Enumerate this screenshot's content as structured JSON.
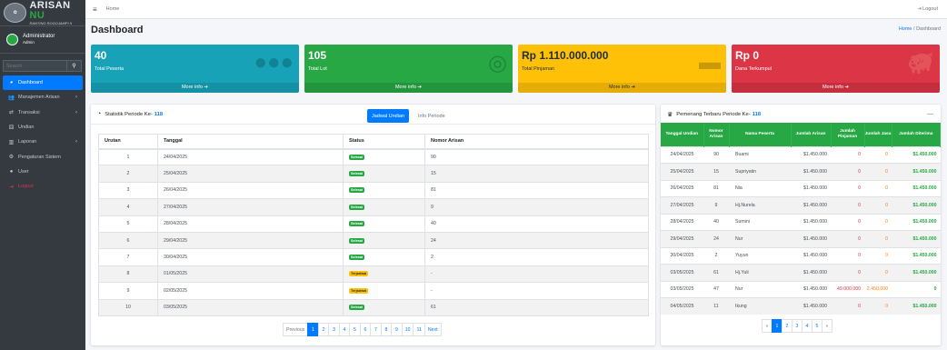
{
  "brand": {
    "logo": "logo",
    "title": "ARISAN",
    "title_accent": "NU",
    "subtitle": "RANTING ROGOJAMPI II"
  },
  "user": {
    "name": "Administrator",
    "role": "Admin"
  },
  "search": {
    "placeholder": "Search",
    "icon": "search-icon"
  },
  "sidebar": {
    "items": [
      {
        "label": "Dashboard",
        "icon": "tachometer-icon",
        "active": true,
        "arrow": ""
      },
      {
        "label": "Manajemen Arisan",
        "icon": "users-icon",
        "active": false,
        "arrow": "‹"
      },
      {
        "label": "Transaksi",
        "icon": "exchange-icon",
        "active": false,
        "arrow": "‹"
      },
      {
        "label": "Undian",
        "icon": "dice-icon",
        "active": false,
        "arrow": ""
      },
      {
        "label": "Laporan",
        "icon": "chart-icon",
        "active": false,
        "arrow": "‹"
      },
      {
        "label": "Pengaturan Sistem",
        "icon": "cogs-icon",
        "active": false,
        "arrow": ""
      },
      {
        "label": "User",
        "icon": "user-icon",
        "active": false,
        "arrow": ""
      },
      {
        "label": "Logout",
        "icon": "sign-out-icon",
        "active": false,
        "arrow": ""
      }
    ]
  },
  "topbar": {
    "home": "Home",
    "logout": "Logout"
  },
  "header": {
    "title": "Dashboard",
    "breadcrumb_home": "Home",
    "breadcrumb_sep": "/",
    "breadcrumb_current": "Dashboard"
  },
  "boxes": [
    {
      "value": "40",
      "label": "Total Peserta",
      "footer": "More info",
      "color": "#17a2b8",
      "icon": "users-icon"
    },
    {
      "value": "105",
      "label": "Total Lot",
      "footer": "More info",
      "color": "#28a745",
      "icon": "coins-icon"
    },
    {
      "value": "Rp 1.110.000.000",
      "label": "Total Pinjaman",
      "footer": "More info",
      "color": "#ffc107",
      "icon": "money-bill-icon"
    },
    {
      "value": "Rp 0",
      "label": "Dana Terkumpul",
      "footer": "More info",
      "color": "#dc3545",
      "icon": "piggy-bank-icon"
    }
  ],
  "stats": {
    "title": "Statistik Periode Ke-",
    "period": "118",
    "tab_active": "Jadwal Undian",
    "tab_inactive": "Info Periode",
    "columns": [
      "Urutan",
      "Tanggal",
      "Status",
      "Nomor Arisan"
    ],
    "rows": [
      {
        "urutan": "1",
        "tanggal": "24/04/2025",
        "status": "Selesai",
        "nomor": "90"
      },
      {
        "urutan": "2",
        "tanggal": "25/04/2025",
        "status": "Selesai",
        "nomor": "15"
      },
      {
        "urutan": "3",
        "tanggal": "26/04/2025",
        "status": "Selesai",
        "nomor": "81"
      },
      {
        "urutan": "4",
        "tanggal": "27/04/2025",
        "status": "Selesai",
        "nomor": "9"
      },
      {
        "urutan": "5",
        "tanggal": "28/04/2025",
        "status": "Selesai",
        "nomor": "40"
      },
      {
        "urutan": "6",
        "tanggal": "29/04/2025",
        "status": "Selesai",
        "nomor": "24"
      },
      {
        "urutan": "7",
        "tanggal": "30/04/2025",
        "status": "Selesai",
        "nomor": "2"
      },
      {
        "urutan": "8",
        "tanggal": "01/05/2025",
        "status": "Terjadwal",
        "nomor": "-"
      },
      {
        "urutan": "9",
        "tanggal": "02/05/2025",
        "status": "Terjadwal",
        "nomor": "-"
      },
      {
        "urutan": "10",
        "tanggal": "03/05/2025",
        "status": "Selesai",
        "nomor": "61"
      }
    ],
    "pagination": [
      "Previous",
      "1",
      "2",
      "3",
      "4",
      "5",
      "6",
      "7",
      "8",
      "9",
      "10",
      "11",
      "Next"
    ],
    "current_page": "1"
  },
  "winners": {
    "title": "Pemenang Terbaru Periode Ke-",
    "period": "118",
    "collapse": "—",
    "columns": [
      "Tanggal Undian",
      "Nomor Arisan",
      "Nama Peserta",
      "Jumlah Arisan",
      "Jumlah Pinjaman",
      "Jumlah Jasa",
      "Jumlah Diterima"
    ],
    "rows": [
      {
        "tanggal": "24/04/2025",
        "nomor": "90",
        "nama": "Buami",
        "arisan": "$1.450.000",
        "pinjaman": "0",
        "jasa": "0",
        "diterima": "$1.450.000"
      },
      {
        "tanggal": "25/04/2025",
        "nomor": "15",
        "nama": "Supriyatin",
        "arisan": "$1.450.000",
        "pinjaman": "0",
        "jasa": "0",
        "diterima": "$1.450.000"
      },
      {
        "tanggal": "26/04/2025",
        "nomor": "81",
        "nama": "Nia",
        "arisan": "$1.450.000",
        "pinjaman": "0",
        "jasa": "0",
        "diterima": "$1.450.000"
      },
      {
        "tanggal": "27/04/2025",
        "nomor": "9",
        "nama": "Hj.Nurela",
        "arisan": "$1.450.000",
        "pinjaman": "0",
        "jasa": "0",
        "diterima": "$1.450.000"
      },
      {
        "tanggal": "28/04/2025",
        "nomor": "40",
        "nama": "Sumini",
        "arisan": "$1.450.000",
        "pinjaman": "0",
        "jasa": "0",
        "diterima": "$1.450.000"
      },
      {
        "tanggal": "29/04/2025",
        "nomor": "24",
        "nama": "Nur",
        "arisan": "$1.450.000",
        "pinjaman": "0",
        "jasa": "0",
        "diterima": "$1.450.000"
      },
      {
        "tanggal": "30/04/2025",
        "nomor": "2",
        "nama": "Yuyun",
        "arisan": "$1.450.000",
        "pinjaman": "0",
        "jasa": "0",
        "diterima": "$1.450.000"
      },
      {
        "tanggal": "03/05/2025",
        "nomor": "61",
        "nama": "Hj.Yuli",
        "arisan": "$1.450.000",
        "pinjaman": "0",
        "jasa": "0",
        "diterima": "$1.450.000"
      },
      {
        "tanggal": "03/05/2025",
        "nomor": "47",
        "nama": "Nur",
        "arisan": "$1.450.000",
        "pinjaman": "49.000.000",
        "jasa": "2.450.000",
        "diterima": "0"
      },
      {
        "tanggal": "04/05/2025",
        "nomor": "11",
        "nama": "Ikung",
        "arisan": "$1.450.000",
        "pinjaman": "0",
        "jasa": "0",
        "diterima": "$1.450.000"
      }
    ],
    "pagination": [
      "«",
      "1",
      "2",
      "3",
      "4",
      "5",
      "»"
    ],
    "current_page": "1"
  }
}
